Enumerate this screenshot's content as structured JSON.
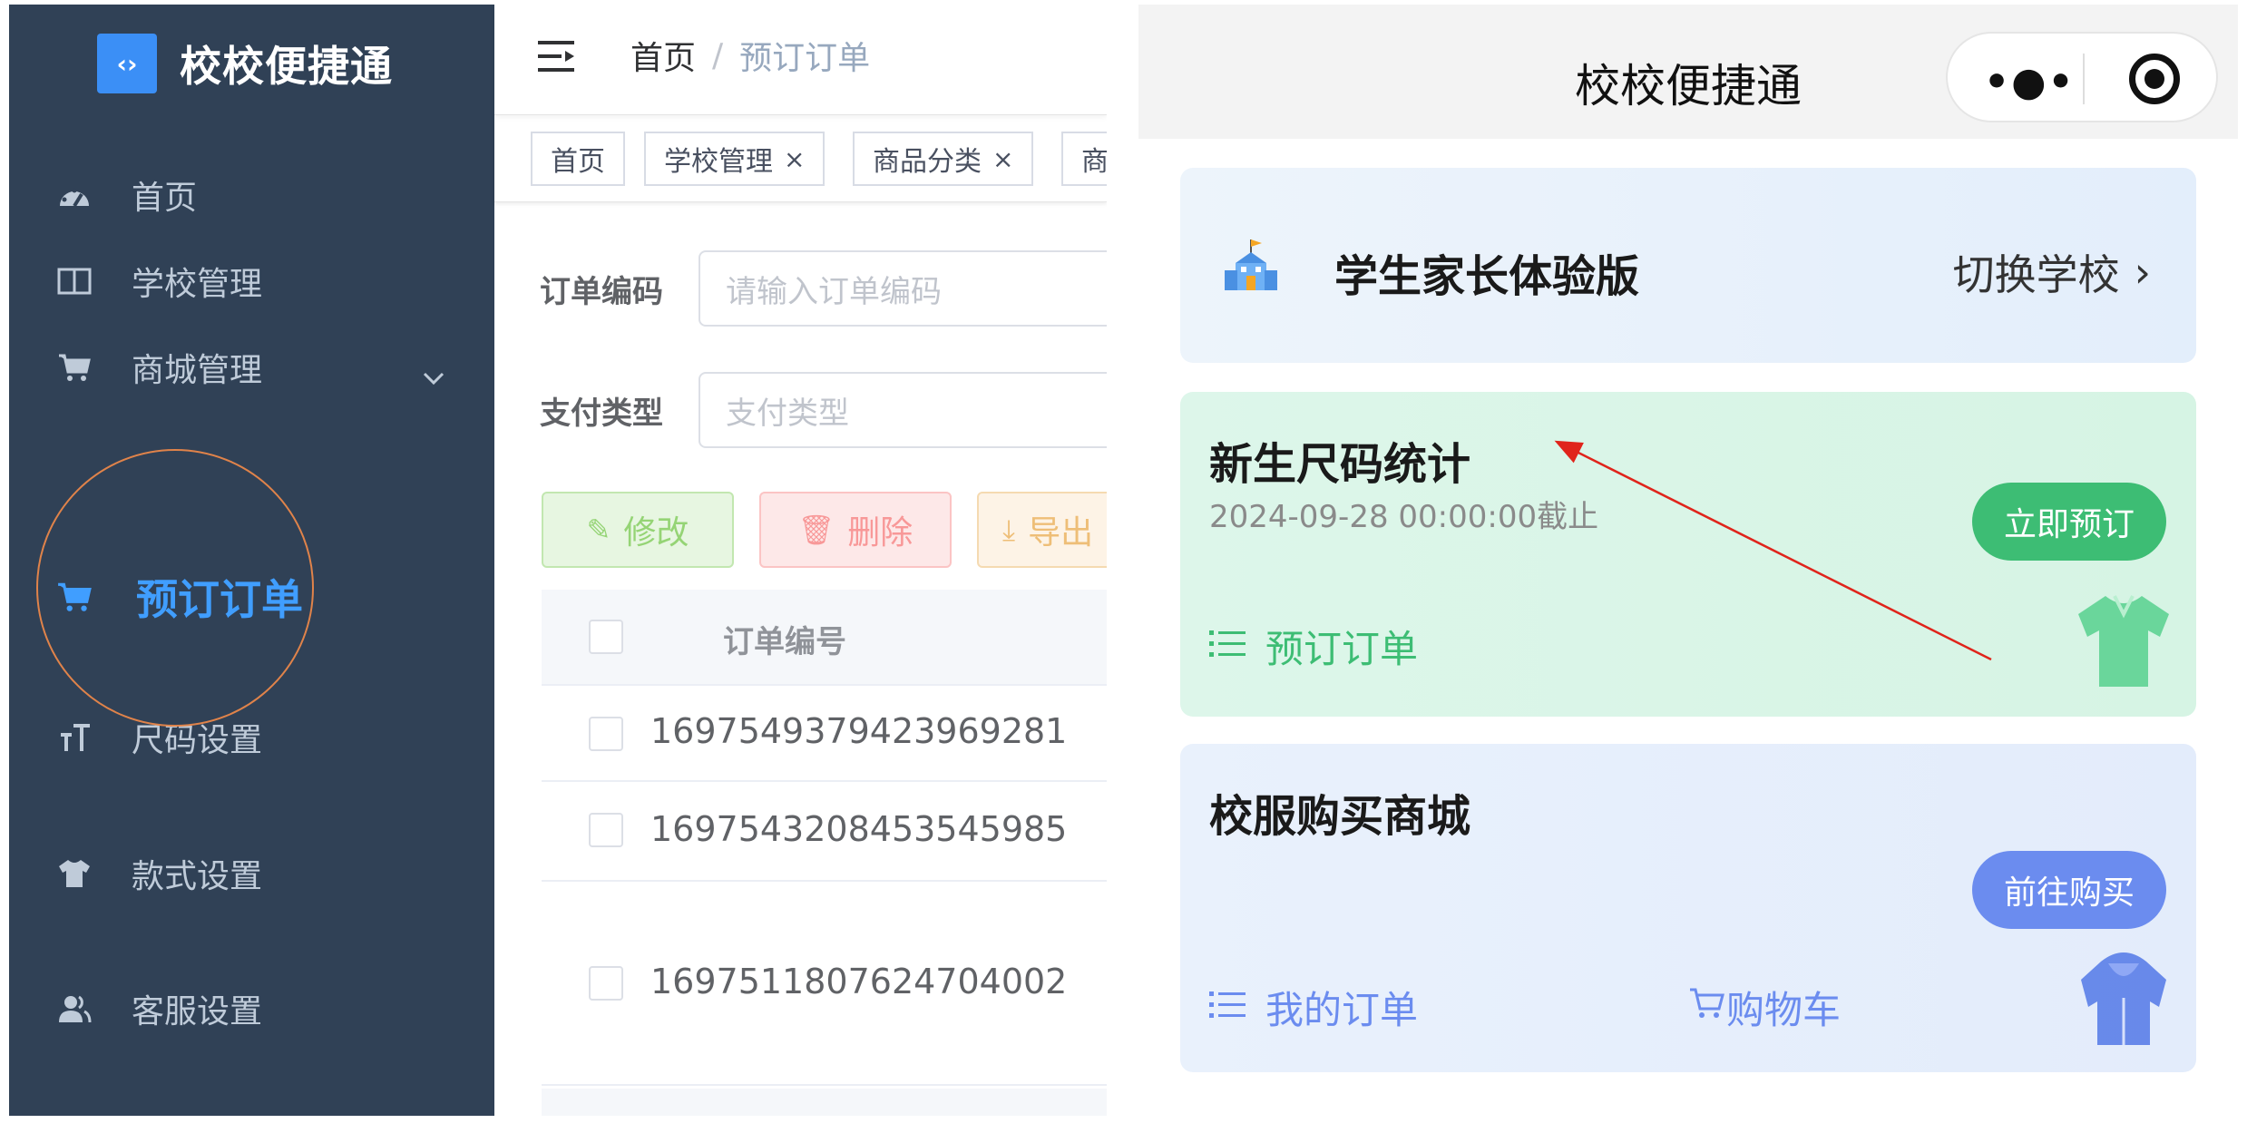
{
  "admin": {
    "logo_glyph": "‹›",
    "logo_text": "校校便捷通",
    "menu": [
      {
        "label": "首页",
        "icon": "dashboard-icon"
      },
      {
        "label": "学校管理",
        "icon": "book-icon"
      },
      {
        "label": "商城管理",
        "icon": "cart-icon"
      },
      {
        "label": "预订订单",
        "icon": "cart-icon"
      },
      {
        "label": "尺码设置",
        "icon": "text-size-icon"
      },
      {
        "label": "款式设置",
        "icon": "shirt-icon"
      },
      {
        "label": "客服设置",
        "icon": "people-icon"
      }
    ],
    "breadcrumb": {
      "home": "首页",
      "sep": "/",
      "current": "预订订单"
    },
    "tags": [
      {
        "label": "首页",
        "closable": false
      },
      {
        "label": "学校管理",
        "closable": true
      },
      {
        "label": "商品分类",
        "closable": true
      },
      {
        "label": "商",
        "closable": false
      }
    ],
    "tag_close": "×",
    "form": {
      "order_no_label": "订单编码",
      "order_no_placeholder": "请输入订单编码",
      "pay_type_label": "支付类型",
      "pay_type_placeholder": "支付类型"
    },
    "buttons": {
      "edit": "修改",
      "delete": "删除",
      "export": "导出"
    },
    "table": {
      "header": "订单编号",
      "rows": [
        "1697549379423969281",
        "1697543208453545985",
        "1697511807624704002"
      ]
    },
    "colors": {
      "sidebar_bg": "#304156",
      "active": "#409eff"
    }
  },
  "mobile": {
    "title": "校校便捷通",
    "capsule_more": "•●•",
    "school_name": "学生家长体验版",
    "switch_school": "切换学校",
    "switch_arrow": "›",
    "size_card": {
      "title": "新生尺码统计",
      "deadline": "2024-09-28 00:00:00截止",
      "button": "立即预订",
      "link": "预订订单"
    },
    "shop_card": {
      "title": "校服购买商城",
      "button": "前往购买",
      "my_orders": "我的订单",
      "cart": "购物车"
    },
    "colors": {
      "green": "#3dbd74",
      "blue": "#6b8cef",
      "arrow": "#e0241b"
    }
  }
}
